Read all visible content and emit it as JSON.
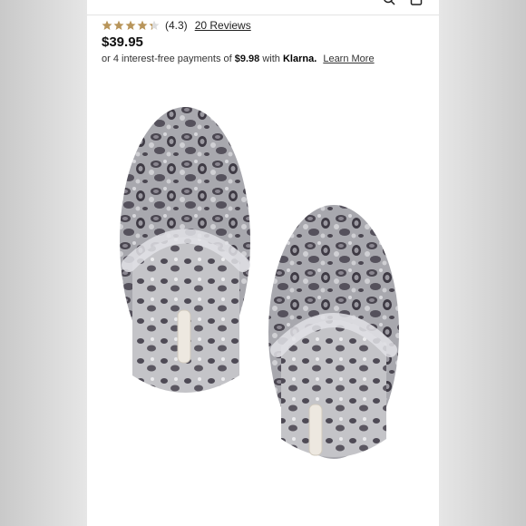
{
  "rating": {
    "stars_filled": 4.3,
    "stars_total": 5,
    "value_text": "(4.3)",
    "reviews_link": "20 Reviews",
    "star_color": "#b8955a"
  },
  "price": "$39.95",
  "klarna": {
    "prefix": "or 4 interest-free payments of",
    "amount": "$9.98",
    "with": "with",
    "brand": "Klarna.",
    "learn_more": "Learn More"
  },
  "product_image": {
    "alt": "leopard print faux fur slippers",
    "icon": "slippers-image"
  },
  "header": {
    "icons": [
      "search-icon",
      "bag-icon"
    ]
  }
}
